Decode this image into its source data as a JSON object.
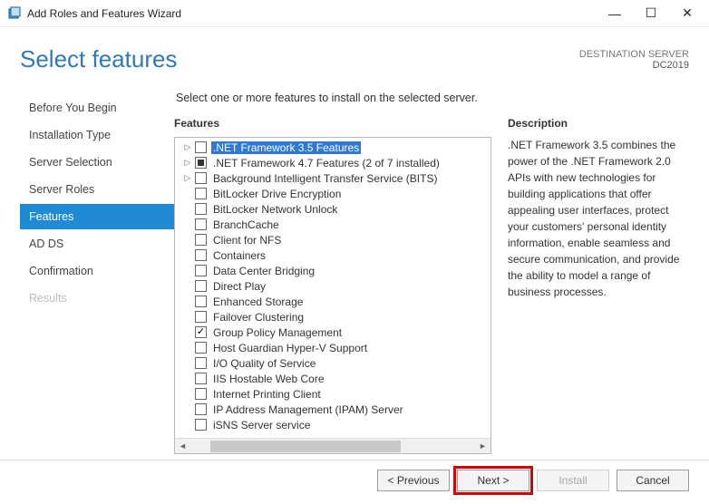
{
  "window": {
    "title": "Add Roles and Features Wizard"
  },
  "header": {
    "title": "Select features",
    "destination_label": "DESTINATION SERVER",
    "destination_server": "DC2019"
  },
  "nav": {
    "items": [
      {
        "label": "Before You Begin",
        "state": "normal"
      },
      {
        "label": "Installation Type",
        "state": "normal"
      },
      {
        "label": "Server Selection",
        "state": "normal"
      },
      {
        "label": "Server Roles",
        "state": "normal"
      },
      {
        "label": "Features",
        "state": "selected"
      },
      {
        "label": "AD DS",
        "state": "normal"
      },
      {
        "label": "Confirmation",
        "state": "normal"
      },
      {
        "label": "Results",
        "state": "disabled"
      }
    ]
  },
  "instructions": "Select one or more features to install on the selected server.",
  "features": {
    "heading": "Features",
    "items": [
      {
        "label": ".NET Framework 3.5 Features",
        "expandable": true,
        "check": "none",
        "selected": true
      },
      {
        "label": ".NET Framework 4.7 Features (2 of 7 installed)",
        "expandable": true,
        "check": "square"
      },
      {
        "label": "Background Intelligent Transfer Service (BITS)",
        "expandable": true,
        "check": "none"
      },
      {
        "label": "BitLocker Drive Encryption",
        "expandable": false,
        "check": "none"
      },
      {
        "label": "BitLocker Network Unlock",
        "expandable": false,
        "check": "none"
      },
      {
        "label": "BranchCache",
        "expandable": false,
        "check": "none"
      },
      {
        "label": "Client for NFS",
        "expandable": false,
        "check": "none"
      },
      {
        "label": "Containers",
        "expandable": false,
        "check": "none"
      },
      {
        "label": "Data Center Bridging",
        "expandable": false,
        "check": "none"
      },
      {
        "label": "Direct Play",
        "expandable": false,
        "check": "none"
      },
      {
        "label": "Enhanced Storage",
        "expandable": false,
        "check": "none"
      },
      {
        "label": "Failover Clustering",
        "expandable": false,
        "check": "none"
      },
      {
        "label": "Group Policy Management",
        "expandable": false,
        "check": "check"
      },
      {
        "label": "Host Guardian Hyper-V Support",
        "expandable": false,
        "check": "none"
      },
      {
        "label": "I/O Quality of Service",
        "expandable": false,
        "check": "none"
      },
      {
        "label": "IIS Hostable Web Core",
        "expandable": false,
        "check": "none"
      },
      {
        "label": "Internet Printing Client",
        "expandable": false,
        "check": "none"
      },
      {
        "label": "IP Address Management (IPAM) Server",
        "expandable": false,
        "check": "none"
      },
      {
        "label": "iSNS Server service",
        "expandable": false,
        "check": "none"
      }
    ]
  },
  "description": {
    "heading": "Description",
    "text": ".NET Framework 3.5 combines the power of the .NET Framework 2.0 APIs with new technologies for building applications that offer appealing user interfaces, protect your customers' personal identity information, enable seamless and secure communication, and provide the ability to model a range of business processes."
  },
  "footer": {
    "previous": "< Previous",
    "next": "Next >",
    "install": "Install",
    "cancel": "Cancel"
  }
}
